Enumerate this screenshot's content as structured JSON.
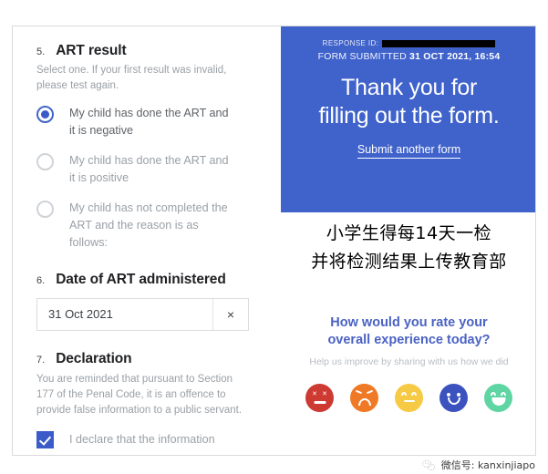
{
  "form": {
    "q5": {
      "number": "5.",
      "title": "ART result",
      "subtitle": "Select one. If your first result was invalid, please test again.",
      "options": [
        {
          "label": "My child has done the ART and it is negative",
          "selected": true
        },
        {
          "label": "My child has done the ART and it is positive",
          "selected": false
        },
        {
          "label": "My child has not completed the ART and the reason is as follows:",
          "selected": false
        }
      ]
    },
    "q6": {
      "number": "6.",
      "title": "Date of ART administered",
      "value": "31 Oct 2021",
      "clear_icon": "×"
    },
    "q7": {
      "number": "7.",
      "title": "Declaration",
      "text": "You are reminded that pursuant to Section 177 of the Penal Code, it is an offence to provide false information to a public servant.",
      "checkbox_label": "I declare that the information",
      "checked": true
    }
  },
  "confirmation": {
    "response_id_label": "RESPONSE ID:",
    "response_id_value": "",
    "submitted_label": "FORM SUBMITTED",
    "submitted_datetime": "31 OCT 2021, 16:54",
    "thanks_line1": "Thank you for",
    "thanks_line2": "filling out the form.",
    "another_form_link": "Submit another form",
    "panel_color": "#3f62cb"
  },
  "chinese_caption": {
    "line1": "小学生得每14天一检",
    "line2": "并将检测结果上传教育部"
  },
  "feedback": {
    "title_line1": "How would you rate your",
    "title_line2": "overall experience today?",
    "subtitle": "Help us improve by sharing with us how we did",
    "title_color": "#4a62c4",
    "ratings": [
      {
        "name": "angry",
        "color": "#cc3a32"
      },
      {
        "name": "sad",
        "color": "#ef7924"
      },
      {
        "name": "neutral",
        "color": "#f7ca46"
      },
      {
        "name": "happy",
        "color": "#3b52bf"
      },
      {
        "name": "very-happy",
        "color": "#5fd5a4"
      }
    ]
  },
  "footer": {
    "wechat_label": "微信号: kanxinjiapo"
  }
}
